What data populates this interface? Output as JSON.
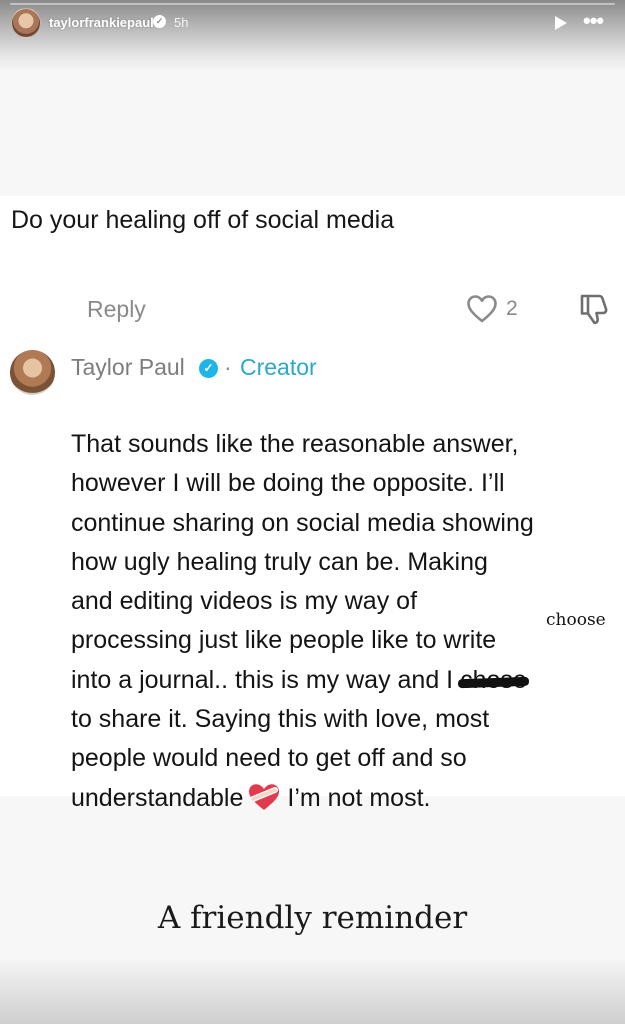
{
  "story": {
    "username": "taylorfrankiepaul",
    "time_ago": "5h",
    "progress": 0.0
  },
  "comment": {
    "question": "Do your healing off of social media",
    "reply_label": "Reply",
    "like_count": "2"
  },
  "creator_reply": {
    "name": "Taylor Paul",
    "separator": "·",
    "badge": "Creator",
    "lines": [
      "That sounds like the reasonable answer,",
      "however I will be doing the opposite. I’ll",
      "continue sharing on social media showing",
      "how ugly healing truly can be. Making",
      "and editing videos is my way of",
      "processing just like people like to write"
    ],
    "line7_before": "into a journal.. this is my way and I ",
    "line7_struck": "chose",
    "handwritten_correction": "choose",
    "line8": "to share it. Saying this with love, most",
    "line9": "people would need to get off and so",
    "line10_before": "understandable",
    "line10_after": "I’m not most."
  },
  "caption": "A friendly reminder",
  "colors": {
    "creator_accent": "#2ba9c7",
    "verified_blue": "#20b5e8",
    "muted_text": "#8a8a8a"
  },
  "icons": [
    "play-icon",
    "more-icon",
    "heart-icon",
    "dislike-icon",
    "verified-icon",
    "mending-heart-emoji"
  ]
}
